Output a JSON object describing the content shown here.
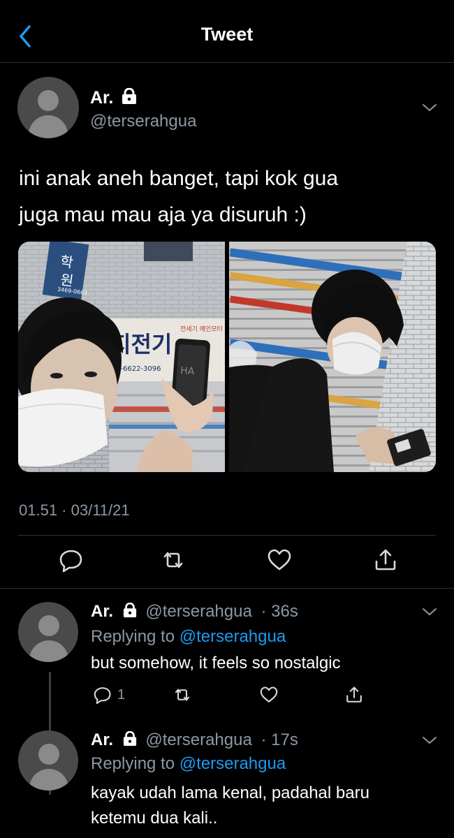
{
  "header": {
    "title": "Tweet"
  },
  "tweet": {
    "name": "Ar.",
    "handle": "@terserahgua",
    "text_line1": "ini anak aneh banget, tapi kok gua",
    "text_line2": "juga mau mau aja ya disuruh :)",
    "timestamp": "01.51 · 03/11/21"
  },
  "replies": [
    {
      "name": "Ar.",
      "handle": "@terserahgua",
      "time": "36s",
      "replying_prefix": "Replying to",
      "replying_handle": "@terserahgua",
      "text": "but somehow, it feels so nostalgic",
      "reply_count": "1"
    },
    {
      "name": "Ar.",
      "handle": "@terserahgua",
      "time": "17s",
      "replying_prefix": "Replying to",
      "replying_handle": "@terserahgua",
      "text_line1": "kayak udah lama kenal, padahal baru",
      "text_line2": "ketemu dua kali.."
    }
  ],
  "photo_signs": {
    "left_sign": "지전기",
    "left_phone_text": "HA",
    "left_phone_number": "6-6622-3096",
    "left_side_sign": "원",
    "left_side_sign2": "학",
    "left_small_sign": "전세기 메인모터",
    "left_number_small": "3469-0667"
  }
}
